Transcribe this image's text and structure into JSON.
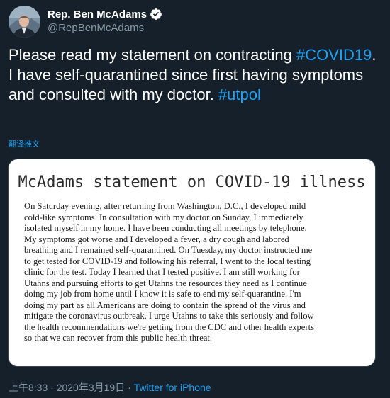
{
  "author": {
    "display_name": "Rep. Ben McAdams",
    "handle": "@RepBenMcAdams",
    "verified": true,
    "verified_icon": "verified-badge-icon",
    "avatar_icon": "profile-photo"
  },
  "tweet": {
    "text_part1": "Please read my statement on contracting ",
    "hashtag1": "#COVID19",
    "text_part2": ". I have self-quarantined since first having symptoms and consulted with my doctor. ",
    "hashtag2": "#utpol",
    "translate_label": "翻译推文"
  },
  "statement_image": {
    "title": "McAdams statement on COVID-19 illness",
    "lines": [
      "On Saturday evening, after returning from Washington, D.C., I developed mild",
      "cold-like symptoms. In consultation with my doctor on Sunday, I immediately",
      "isolated myself in my home. I have been conducting all meetings by telephone.",
      "My symptoms got worse and I developed a fever, a dry cough and labored",
      "breathing and I remained self-quarantined. On Tuesday, my doctor instructed me",
      "to get tested for COVID-19 and following his referral, I went to the local testing",
      "clinic for the test. Today I learned that I tested positive.  I am still working for",
      "Utahns and pursuing efforts to get Utahns the resources they need as I continue",
      "doing my job from home until I know it is safe to end my self-quarantine. I'm",
      "doing my part as all Americans are doing to contain the spread of the virus and",
      "mitigate the coronavirus outbreak. I urge Utahns to take this seriously and follow",
      "the health recommendations we're getting from the CDC and other health experts",
      "so that we can recover from this public health threat."
    ]
  },
  "footer": {
    "timestamp": "上午8:33 · 2020年3月19日 · ",
    "source": "Twitter for iPhone"
  },
  "colors": {
    "background": "#15202b",
    "accent": "#1da1f2",
    "secondary_text": "#8899a6"
  }
}
